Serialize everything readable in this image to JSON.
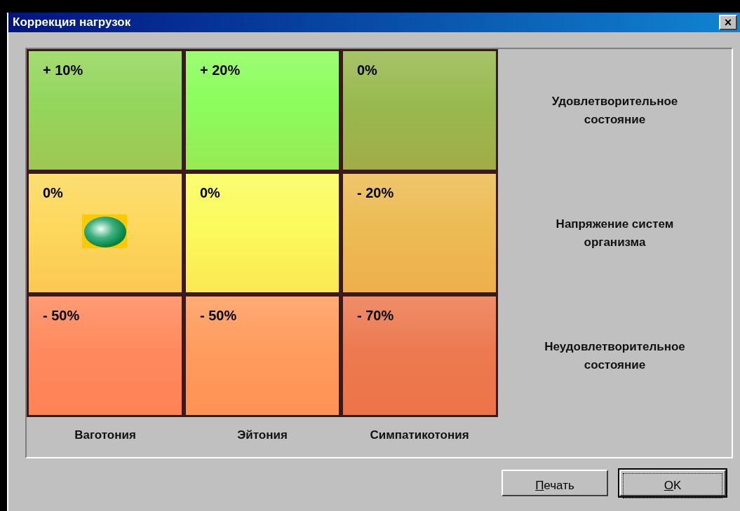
{
  "window": {
    "title": "Коррекция нагрузок",
    "close_label": "×"
  },
  "matrix": {
    "bands": [
      {
        "zones": [
          {
            "text": "+ 10%",
            "color": "#94d65c",
            "marker": false
          },
          {
            "text": "+ 20%",
            "color": "#8cfd5c",
            "marker": false
          },
          {
            "text": "0%",
            "color": "#98b94f",
            "marker": false
          }
        ],
        "state_label": "Удовлетворительное состояние"
      },
      {
        "zones": [
          {
            "text": "0%",
            "color": "#fcd85c",
            "marker": true
          },
          {
            "text": "0%",
            "color": "#fbfb5c",
            "marker": false
          },
          {
            "text": "- 20%",
            "color": "#ecbc54",
            "marker": false
          }
        ],
        "state_label": "Напряжение систем организма"
      },
      {
        "zones": [
          {
            "text": "- 50%",
            "color": "#ff8a5e",
            "marker": false
          },
          {
            "text": "- 50%",
            "color": "#ff9c5e",
            "marker": false
          },
          {
            "text": "- 70%",
            "color": "#ec7a50",
            "marker": false
          }
        ],
        "state_label": "Неудовлетворительное состояние"
      }
    ]
  },
  "tone_labels": [
    "Ваготония",
    "Эйтония",
    "Симпатикотония"
  ],
  "buttons": [
    {
      "label": "Печать",
      "default": false
    },
    {
      "label": "OK",
      "default": true
    }
  ]
}
